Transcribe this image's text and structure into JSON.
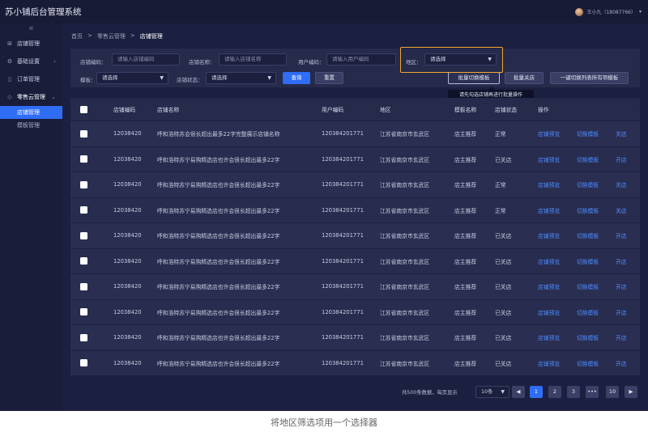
{
  "app": {
    "title": "苏小铺后台管理系统",
    "user": "王小九（18087766）"
  },
  "sidebar": {
    "collapse_glyph": "≡",
    "items": [
      {
        "label": "店铺管理",
        "icon": "grid-icon"
      },
      {
        "label": "基础设置",
        "icon": "settings-icon"
      },
      {
        "label": "订单管理",
        "icon": "document-icon"
      },
      {
        "label": "零售云管理",
        "icon": "cloud-icon"
      }
    ],
    "sub_items": [
      "店铺管理",
      "模板管理"
    ]
  },
  "breadcrumb": {
    "items": [
      "首页",
      "零售云管理",
      "店铺管理"
    ],
    "separator": ">"
  },
  "filters": {
    "store_code": {
      "label": "店铺编码：",
      "placeholder": "请输入店铺编码"
    },
    "store_name": {
      "label": "店铺名称：",
      "placeholder": "请输入店铺名称"
    },
    "user_code": {
      "label": "用户编码：",
      "placeholder": "请输入用户编码"
    },
    "region": {
      "label": "地区：",
      "value": "请选择"
    },
    "template": {
      "label": "模板：",
      "value": "请选择"
    },
    "store_status": {
      "label": "店铺状态：",
      "value": "请选择"
    },
    "query": "查询",
    "reset": "重置",
    "batch_switch": "批量切换模板",
    "batch_close": "批量关店",
    "one_key": "一键切换列表所有项模板",
    "tooltip": "请先勾选店铺再进行批量操作"
  },
  "table": {
    "headers": [
      "店铺编码",
      "店铺名称",
      "用户编码",
      "地区",
      "模板名称",
      "店铺状态",
      "操作"
    ],
    "rows": [
      {
        "code": "12038420",
        "name": "呼和浩特苏会很长超出最多22字完整展示店铺名称",
        "user": "120384201771",
        "region": "江苏省南京市玄武区",
        "template": "店主推荐",
        "status": "正常",
        "a1": "店铺预览",
        "a2": "切换模板",
        "a3": "关店"
      },
      {
        "code": "12038420",
        "name": "呼和浩特苏宁易购精选店也许会很长超出最多22字",
        "user": "120384201771",
        "region": "江苏省南京市玄武区",
        "template": "店主推荐",
        "status": "已关店",
        "a1": "店铺预览",
        "a2": "切换模板",
        "a3": "开店"
      },
      {
        "code": "12038420",
        "name": "呼和浩特苏宁易购精选店也许会很长超出最多22字",
        "user": "120384201771",
        "region": "江苏省南京市玄武区",
        "template": "店主推荐",
        "status": "正常",
        "a1": "店铺预览",
        "a2": "切换模板",
        "a3": "关店"
      },
      {
        "code": "12038420",
        "name": "呼和浩特苏宁易购精选店也许会很长超出最多22字",
        "user": "120384201771",
        "region": "江苏省南京市玄武区",
        "template": "店主推荐",
        "status": "正常",
        "a1": "店铺预览",
        "a2": "切换模板",
        "a3": "关店"
      },
      {
        "code": "12038420",
        "name": "呼和浩特苏宁易购精选店也许会很长超出最多22字",
        "user": "120384201771",
        "region": "江苏省南京市玄武区",
        "template": "店主推荐",
        "status": "已关店",
        "a1": "店铺预览",
        "a2": "切换模板",
        "a3": "开店"
      },
      {
        "code": "12038420",
        "name": "呼和浩特苏宁易购精选店也许会很长超出最多22字",
        "user": "120384201771",
        "region": "江苏省南京市玄武区",
        "template": "店主推荐",
        "status": "已关店",
        "a1": "店铺预览",
        "a2": "切换模板",
        "a3": "开店"
      },
      {
        "code": "12038420",
        "name": "呼和浩特苏宁易购精选店也许会很长超出最多22字",
        "user": "120384201771",
        "region": "江苏省南京市玄武区",
        "template": "店主推荐",
        "status": "已关店",
        "a1": "店铺预览",
        "a2": "切换模板",
        "a3": "开店"
      },
      {
        "code": "12038420",
        "name": "呼和浩特苏宁易购精选店也许会很长超出最多22字",
        "user": "120384201771",
        "region": "江苏省南京市玄武区",
        "template": "店主推荐",
        "status": "已关店",
        "a1": "店铺预览",
        "a2": "切换模板",
        "a3": "开店"
      },
      {
        "code": "12038420",
        "name": "呼和浩特苏宁易购精选店也许会很长超出最多22字",
        "user": "120384201771",
        "region": "江苏省南京市玄武区",
        "template": "店主推荐",
        "status": "已关店",
        "a1": "店铺预览",
        "a2": "切换模板",
        "a3": "开店"
      },
      {
        "code": "12038420",
        "name": "呼和浩特苏宁易购精选店也许会很长超出最多22字",
        "user": "120384201771",
        "region": "江苏省南京市玄武区",
        "template": "店主推荐",
        "status": "已关店",
        "a1": "店铺预览",
        "a2": "切换模板",
        "a3": "开店"
      }
    ]
  },
  "pagination": {
    "total": "共500条数据，每页显示",
    "page_size": "10条",
    "pages": [
      "1",
      "2",
      "3",
      "•••",
      "10"
    ],
    "current": "1"
  },
  "caption": "将地区筛选项用一个选择器",
  "colors": {
    "accent": "#2f6df5",
    "link": "#4d8cff",
    "highlight": "#f0a830",
    "background": "#1c2040"
  }
}
